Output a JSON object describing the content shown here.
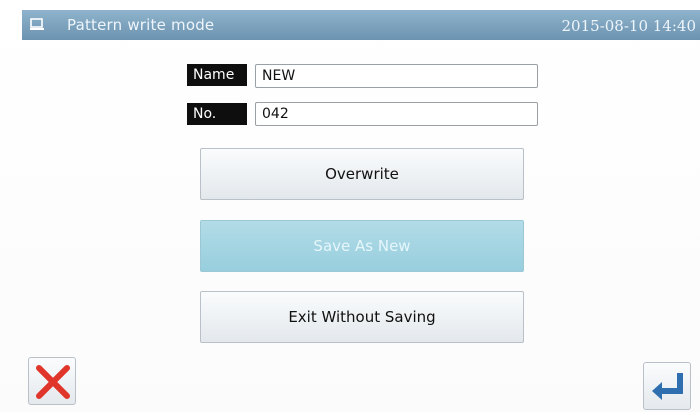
{
  "titlebar": {
    "title": "Pattern write mode",
    "datetime": "2015-08-10 14:40",
    "icon": "screen-icon"
  },
  "form": {
    "name_label": "Name",
    "name_value": "NEW",
    "no_label": "No.",
    "no_value": "042"
  },
  "buttons": {
    "overwrite": "Overwrite",
    "save_as_new": "Save As New",
    "exit_without_saving": "Exit Without Saving"
  },
  "icons": {
    "cancel": "close-icon",
    "confirm": "enter-icon"
  },
  "colors": {
    "titlebar": "#7fa3bf",
    "disabled_button": "#a6d5e2",
    "cancel_icon": "#e0352b",
    "enter_icon": "#2f6fb0"
  }
}
